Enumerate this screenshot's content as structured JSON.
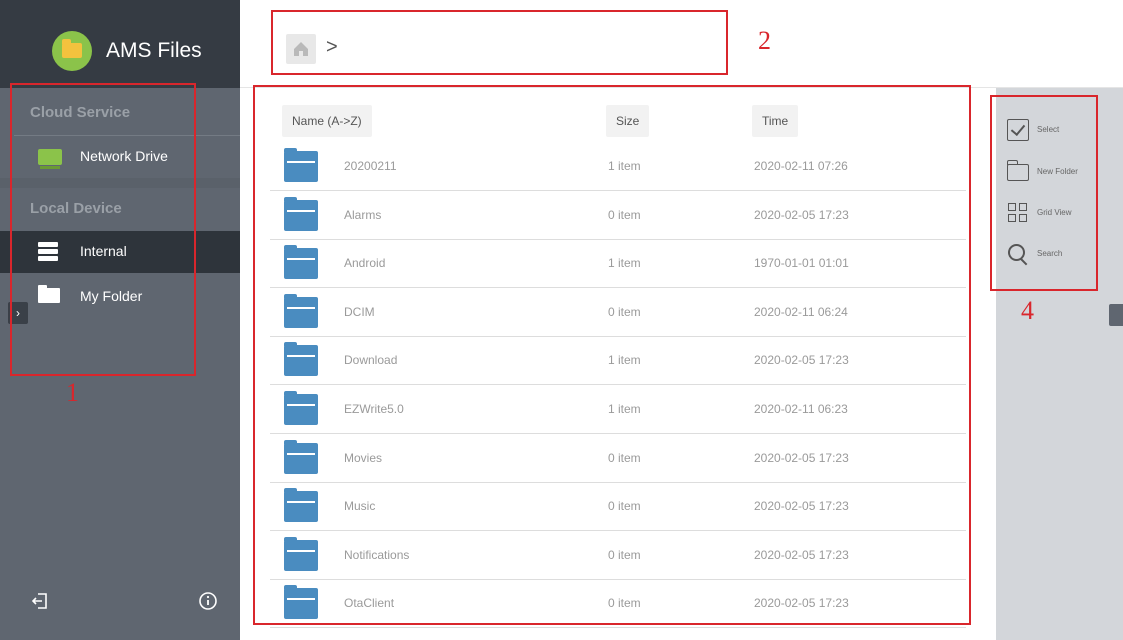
{
  "app": {
    "title": "AMS Files"
  },
  "sidebar": {
    "cloud_section": "Cloud Service",
    "network_drive": "Network Drive",
    "local_section": "Local Device",
    "internal": "Internal",
    "my_folder": "My Folder"
  },
  "breadcrumb": {
    "separator": ">"
  },
  "columns": {
    "name": "Name (A->Z)",
    "size": "Size",
    "time": "Time"
  },
  "files": [
    {
      "name": "20200211",
      "size": "1 item",
      "time": "2020-02-11 07:26"
    },
    {
      "name": "Alarms",
      "size": "0 item",
      "time": "2020-02-05 17:23"
    },
    {
      "name": "Android",
      "size": "1 item",
      "time": "1970-01-01 01:01"
    },
    {
      "name": "DCIM",
      "size": "0 item",
      "time": "2020-02-11 06:24"
    },
    {
      "name": "Download",
      "size": "1 item",
      "time": "2020-02-05 17:23"
    },
    {
      "name": "EZWrite5.0",
      "size": "1 item",
      "time": "2020-02-11 06:23"
    },
    {
      "name": "Movies",
      "size": "0 item",
      "time": "2020-02-05 17:23"
    },
    {
      "name": "Music",
      "size": "0 item",
      "time": "2020-02-05 17:23"
    },
    {
      "name": "Notifications",
      "size": "0 item",
      "time": "2020-02-05 17:23"
    },
    {
      "name": "OtaClient",
      "size": "0 item",
      "time": "2020-02-05 17:23"
    }
  ],
  "actions": {
    "select": "Select",
    "new_folder": "New Folder",
    "grid_view": "Grid View",
    "search": "Search"
  },
  "icons": {
    "logo": "ams-files-logo-icon",
    "network_drive": "network-drive-icon",
    "internal": "internal-storage-icon",
    "my_folder": "folder-icon",
    "expand": "chevron-right-icon",
    "exit": "exit-icon",
    "info": "info-icon",
    "home": "home-icon",
    "file_folder": "folder-icon",
    "select": "checkbox-icon",
    "new_folder": "new-folder-icon",
    "grid_view": "grid-icon",
    "search": "search-icon"
  },
  "annotations": {
    "sidebar": "1",
    "breadcrumb": "2",
    "actions": "4"
  },
  "colors": {
    "sidebar_bg": "#5f6670",
    "sidebar_header": "#353b43",
    "active_item": "#2e343b",
    "folder_blue": "#4a8cc0",
    "annotation_red": "#d9262c",
    "panel_bg": "#d3d6da",
    "logo_green": "#8bc34a"
  }
}
